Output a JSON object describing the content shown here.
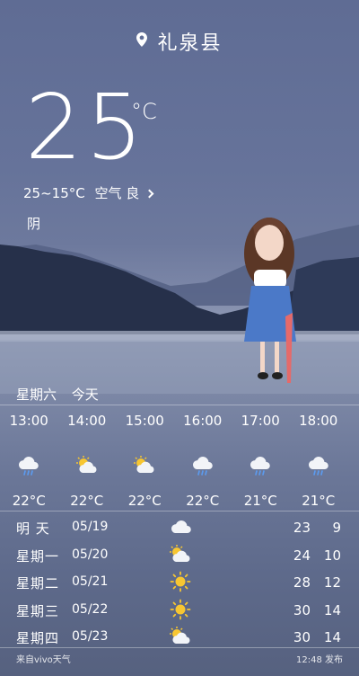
{
  "location": {
    "city": "礼泉县"
  },
  "current": {
    "temperature": "25",
    "unit": "°C",
    "range": "25~15°C",
    "air_quality": "空气 良",
    "condition": "阴"
  },
  "hourly": {
    "day_label": "星期六",
    "today_label": "今天",
    "items": [
      {
        "time": "13:00",
        "icon": "cloud-rain-icon",
        "temp": "22°C"
      },
      {
        "time": "14:00",
        "icon": "sun-cloud-icon",
        "temp": "22°C"
      },
      {
        "time": "15:00",
        "icon": "sun-cloud-icon",
        "temp": "22°C"
      },
      {
        "time": "16:00",
        "icon": "cloud-rain-icon",
        "temp": "22°C"
      },
      {
        "time": "17:00",
        "icon": "cloud-rain-icon",
        "temp": "21°C"
      },
      {
        "time": "18:00",
        "icon": "cloud-rain-icon",
        "temp": "21°C"
      }
    ]
  },
  "daily": [
    {
      "day": "明 天",
      "date": "05/19",
      "icon": "cloud-icon",
      "high": "23",
      "low": "9"
    },
    {
      "day": "星期一",
      "date": "05/20",
      "icon": "sun-cloud-icon",
      "high": "24",
      "low": "10"
    },
    {
      "day": "星期二",
      "date": "05/21",
      "icon": "sun-icon",
      "high": "28",
      "low": "12"
    },
    {
      "day": "星期三",
      "date": "05/22",
      "icon": "sun-icon",
      "high": "30",
      "low": "14"
    },
    {
      "day": "星期四",
      "date": "05/23",
      "icon": "sun-cloud-icon",
      "high": "30",
      "low": "14"
    }
  ],
  "footer": {
    "source": "来自vivo天气",
    "published": "12:48 发布"
  },
  "colors": {
    "sun": "#f7c631",
    "sky_top": "#5f6c94",
    "lake": "#8f99b4"
  }
}
